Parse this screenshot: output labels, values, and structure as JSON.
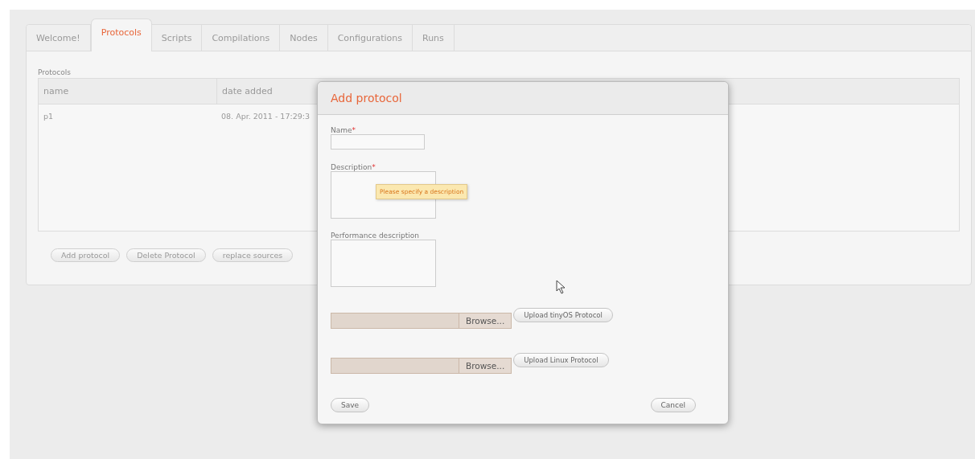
{
  "tabs": [
    {
      "label": "Welcome!",
      "selected": false
    },
    {
      "label": "Protocols",
      "selected": true
    },
    {
      "label": "Scripts",
      "selected": false
    },
    {
      "label": "Compilations",
      "selected": false
    },
    {
      "label": "Nodes",
      "selected": false
    },
    {
      "label": "Configurations",
      "selected": false
    },
    {
      "label": "Runs",
      "selected": false
    }
  ],
  "section_title": "Protocols",
  "table": {
    "columns": [
      "name",
      "date added"
    ],
    "rows": [
      [
        "p1",
        "08. Apr. 2011 - 17:29:3"
      ]
    ]
  },
  "buttons": [
    "Add protocol",
    "Delete Protocol",
    "replace sources"
  ],
  "dialog": {
    "title": "Add protocol",
    "fields": [
      {
        "label": "Name",
        "required_mark": "*",
        "kind": "input"
      },
      {
        "label": "Description",
        "required_mark": "*",
        "kind": "textarea",
        "tooltip": "Please specify a description"
      },
      {
        "label": "Performance description",
        "kind": "textarea"
      }
    ],
    "uploads": [
      {
        "browse": "Browse...",
        "upload": "Upload tinyOS Protocol"
      },
      {
        "browse": "Browse...",
        "upload": "Upload Linux Protocol"
      }
    ],
    "buttons": [
      "Save",
      "Cancel"
    ]
  }
}
